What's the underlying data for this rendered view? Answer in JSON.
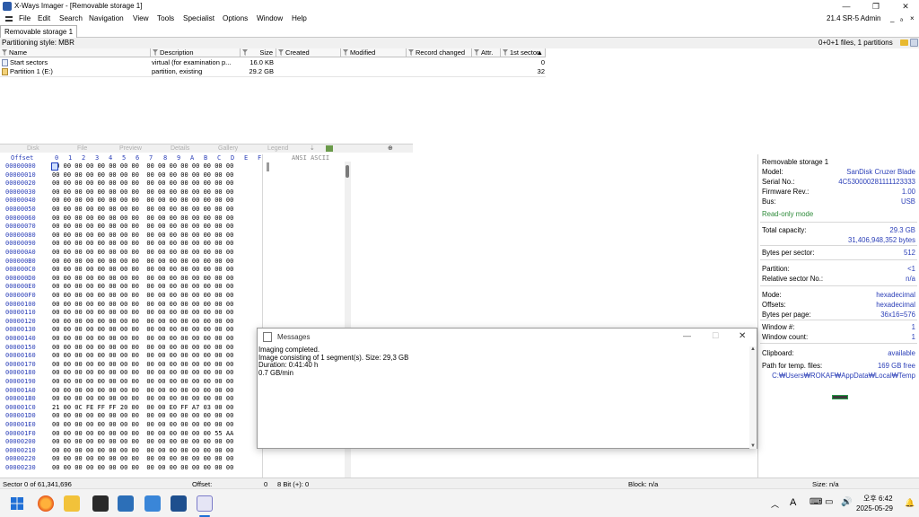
{
  "window": {
    "title": "X-Ways Imager - [Removable storage 1]",
    "controls": {
      "minimize": "—",
      "maximize": "❐",
      "close": "✕"
    }
  },
  "menu": {
    "items": [
      "File",
      "Edit",
      "Search",
      "Navigation",
      "View",
      "Tools",
      "Specialist",
      "Options",
      "Window",
      "Help"
    ],
    "version": "21.4 SR-5 Admin",
    "right_controls": [
      "_",
      "ₐ",
      "×"
    ]
  },
  "tabs": [
    {
      "label": "Removable storage 1"
    }
  ],
  "partition_status": {
    "left": "Partitioning style: MBR",
    "right": "0+0+1 files, 1 partitions"
  },
  "file_list": {
    "columns": [
      "Name",
      "Description",
      "Size",
      "Created",
      "Modified",
      "Record changed",
      "Attr.",
      "1st sector"
    ],
    "rows": [
      {
        "name": "Start sectors",
        "description": "virtual (for examination p...",
        "size": "16.0 KB",
        "first_sector": "0"
      },
      {
        "name": "Partition 1 (E:)",
        "description": "partition, existing",
        "size": "29.2 GB",
        "first_sector": "32"
      }
    ]
  },
  "mode_tabs": [
    "Disk",
    "File",
    "Preview",
    "Details",
    "Gallery",
    "Legend"
  ],
  "hex": {
    "header_offset": "Offset",
    "header_cols": [
      "0",
      "1",
      "2",
      "3",
      "4",
      "5",
      "6",
      "7",
      "8",
      "9",
      "A",
      "B",
      "C",
      "D",
      "E",
      "F"
    ],
    "header_text": "ANSI ASCII",
    "rows": [
      [
        "00000000",
        "00 00 00 00 00 00 00 00  00 00 00 00 00 00 00 00"
      ],
      [
        "00000010",
        "00 00 00 00 00 00 00 00  00 00 00 00 00 00 00 00"
      ],
      [
        "00000020",
        "00 00 00 00 00 00 00 00  00 00 00 00 00 00 00 00"
      ],
      [
        "00000030",
        "00 00 00 00 00 00 00 00  00 00 00 00 00 00 00 00"
      ],
      [
        "00000040",
        "00 00 00 00 00 00 00 00  00 00 00 00 00 00 00 00"
      ],
      [
        "00000050",
        "00 00 00 00 00 00 00 00  00 00 00 00 00 00 00 00"
      ],
      [
        "00000060",
        "00 00 00 00 00 00 00 00  00 00 00 00 00 00 00 00"
      ],
      [
        "00000070",
        "00 00 00 00 00 00 00 00  00 00 00 00 00 00 00 00"
      ],
      [
        "00000080",
        "00 00 00 00 00 00 00 00  00 00 00 00 00 00 00 00"
      ],
      [
        "00000090",
        "00 00 00 00 00 00 00 00  00 00 00 00 00 00 00 00"
      ],
      [
        "000000A0",
        "00 00 00 00 00 00 00 00  00 00 00 00 00 00 00 00"
      ],
      [
        "000000B0",
        "00 00 00 00 00 00 00 00  00 00 00 00 00 00 00 00"
      ],
      [
        "000000C0",
        "00 00 00 00 00 00 00 00  00 00 00 00 00 00 00 00"
      ],
      [
        "000000D0",
        "00 00 00 00 00 00 00 00  00 00 00 00 00 00 00 00"
      ],
      [
        "000000E0",
        "00 00 00 00 00 00 00 00  00 00 00 00 00 00 00 00"
      ],
      [
        "000000F0",
        "00 00 00 00 00 00 00 00  00 00 00 00 00 00 00 00"
      ],
      [
        "00000100",
        "00 00 00 00 00 00 00 00  00 00 00 00 00 00 00 00"
      ],
      [
        "00000110",
        "00 00 00 00 00 00 00 00  00 00 00 00 00 00 00 00"
      ],
      [
        "00000120",
        "00 00 00 00 00 00 00 00  00 00 00 00 00 00 00 00"
      ],
      [
        "00000130",
        "00 00 00 00 00 00 00 00  00 00 00 00 00 00 00 00"
      ],
      [
        "00000140",
        "00 00 00 00 00 00 00 00  00 00 00 00 00 00 00 00"
      ],
      [
        "00000150",
        "00 00 00 00 00 00 00 00  00 00 00 00 00 00 00 00"
      ],
      [
        "00000160",
        "00 00 00 00 00 00 00 00  00 00 00 00 00 00 00 00"
      ],
      [
        "00000170",
        "00 00 00 00 00 00 00 00  00 00 00 00 00 00 00 00"
      ],
      [
        "00000180",
        "00 00 00 00 00 00 00 00  00 00 00 00 00 00 00 00"
      ],
      [
        "00000190",
        "00 00 00 00 00 00 00 00  00 00 00 00 00 00 00 00"
      ],
      [
        "000001A0",
        "00 00 00 00 00 00 00 00  00 00 00 00 00 00 00 00"
      ],
      [
        "000001B0",
        "00 00 00 00 00 00 00 00  00 00 00 00 00 00 00 00"
      ],
      [
        "000001C0",
        "21 00 0C FE FF FF 20 00  00 00 E0 FF A7 03 00 00"
      ],
      [
        "000001D0",
        "00 00 00 00 00 00 00 00  00 00 00 00 00 00 00 00"
      ],
      [
        "000001E0",
        "00 00 00 00 00 00 00 00  00 00 00 00 00 00 00 00"
      ],
      [
        "000001F0",
        "00 00 00 00 00 00 00 00  00 00 00 00 00 00 55 AA"
      ],
      [
        "00000200",
        "00 00 00 00 00 00 00 00  00 00 00 00 00 00 00 00"
      ],
      [
        "00000210",
        "00 00 00 00 00 00 00 00  00 00 00 00 00 00 00 00"
      ],
      [
        "00000220",
        "00 00 00 00 00 00 00 00  00 00 00 00 00 00 00 00"
      ],
      [
        "00000230",
        "00 00 00 00 00 00 00 00  00 00 00 00 00 00 00 00"
      ]
    ]
  },
  "info_panel": {
    "title": "Removable storage 1",
    "model_label": "Model:",
    "model": "SanDisk Cruzer Blade",
    "serial_label": "Serial No.:",
    "serial": "4C530000281111123333",
    "firmware_label": "Firmware Rev.:",
    "firmware": "1.00",
    "bus_label": "Bus:",
    "bus": "USB",
    "readonly": "Read-only mode",
    "capacity_label": "Total capacity:",
    "capacity_gb": "29.3 GB",
    "capacity_bytes": "31,406,948,352 bytes",
    "bps_label": "Bytes per sector:",
    "bps": "512",
    "partition_label": "Partition:",
    "partition": "<1",
    "relsector_label": "Relative sector No.:",
    "relsector": "n/a",
    "mode_label": "Mode:",
    "mode": "hexadecimal",
    "offsets_label": "Offsets:",
    "offsets": "hexadecimal",
    "bpp_label": "Bytes per page:",
    "bpp": "36x16=576",
    "winnum_label": "Window #:",
    "winnum": "1",
    "wincount_label": "Window count:",
    "wincount": "1",
    "clipboard_label": "Clipboard:",
    "clipboard": "available",
    "temp_label": "Path for temp. files:",
    "temp_free": "169 GB free",
    "temp_path": "C:₩Users₩ROKAF₩AppData₩Local₩Temp"
  },
  "messages": {
    "title": "Messages",
    "lines": [
      "Imaging completed.",
      "Image consisting of 1 segment(s). Size: 29,3 GB",
      "Duration: 0:41:40 h",
      "0.7 GB/min"
    ]
  },
  "status_bar": {
    "sector": "Sector 0 of 61,341,696",
    "offset": "Offset:",
    "offset_val": "0",
    "bit": "8 Bit (+): 0",
    "block": "Block: n/a",
    "size": "Size: n/a"
  },
  "taskbar": {
    "lang": "A",
    "time_ampm": "오후 6:42",
    "date": "2025-05-29"
  }
}
